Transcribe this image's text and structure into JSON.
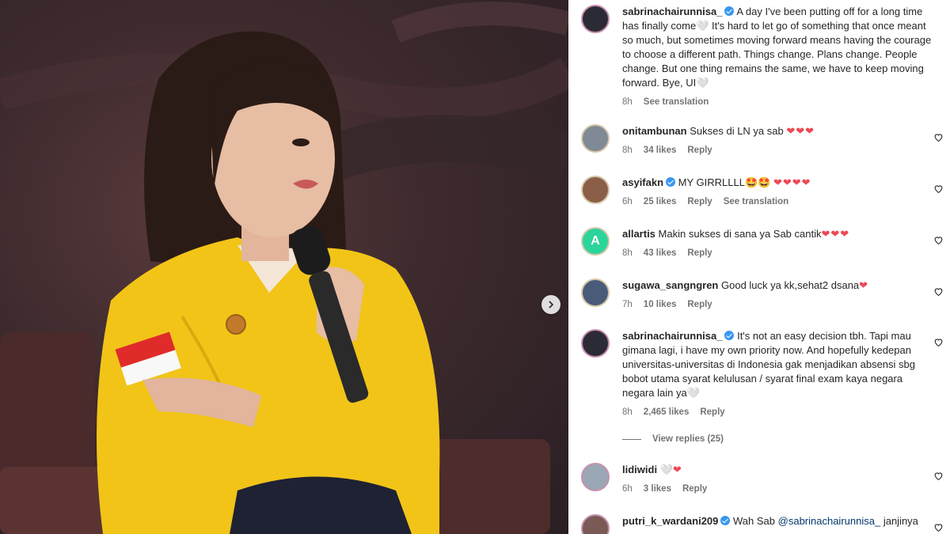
{
  "post": {
    "author": "sabrinachairunnisa_",
    "caption": "A day I've been putting off for a long time has finally come🤍 It's hard to let go of something that once meant so much, but sometimes moving forward means having the courage to choose a different path. Things change. Plans change. People change. But one thing remains the same, we have to keep moving forward. Bye, UI🤍",
    "time": "8h",
    "see_translation": "See translation"
  },
  "comments": [
    {
      "user": "onitambunan",
      "verified": false,
      "text": "Sukses di LN ya sab",
      "emoji": "❤❤❤",
      "time": "8h",
      "likes": "34 likes",
      "reply": "Reply",
      "translate": ""
    },
    {
      "user": "asyifakn",
      "verified": true,
      "text": "MY GIRRLLLL🤩🤩",
      "emoji": "❤❤❤❤",
      "time": "6h",
      "likes": "25 likes",
      "reply": "Reply",
      "translate": "See translation"
    },
    {
      "user": "allartis",
      "verified": false,
      "text": "Makin sukses di sana ya Sab cantik",
      "emoji": "❤❤❤",
      "time": "8h",
      "likes": "43 likes",
      "reply": "Reply",
      "translate": ""
    },
    {
      "user": "sugawa_sangngren",
      "verified": false,
      "text": "Good luck ya kk,sehat2 dsana",
      "emoji": "❤",
      "time": "7h",
      "likes": "10 likes",
      "reply": "Reply",
      "translate": ""
    },
    {
      "user": "sabrinachairunnisa_",
      "verified": true,
      "text": "It's not an easy decision tbh. Tapi mau gimana lagi, i have my own priority now. And hopefully kedepan universitas-universitas di Indonesia gak menjadikan absensi sbg bobot utama syarat kelulusan / syarat final exam kaya negara negara lain ya🤍",
      "emoji": "",
      "time": "8h",
      "likes": "2,465 likes",
      "reply": "Reply",
      "translate": ""
    },
    {
      "user": "lidiwidi",
      "verified": false,
      "text": "🤍",
      "emoji": "❤",
      "time": "6h",
      "likes": "3 likes",
      "reply": "Reply",
      "translate": ""
    },
    {
      "user": "putri_k_wardani209",
      "verified": true,
      "text": "Wah Sab",
      "mention": "@sabrinachairunnisa_",
      "text2": "janjinya",
      "emoji": "",
      "time": "",
      "likes": "",
      "reply": "",
      "translate": ""
    }
  ],
  "view_replies": "View replies (25)",
  "avatar_letter": "A",
  "colors": {
    "verified": "#3897f0",
    "heart": "#ed4956",
    "meta": "#737373",
    "jacket": "#f2c418"
  },
  "icons": [
    "verified-icon",
    "heart-outline-icon",
    "chevron-right-icon"
  ]
}
